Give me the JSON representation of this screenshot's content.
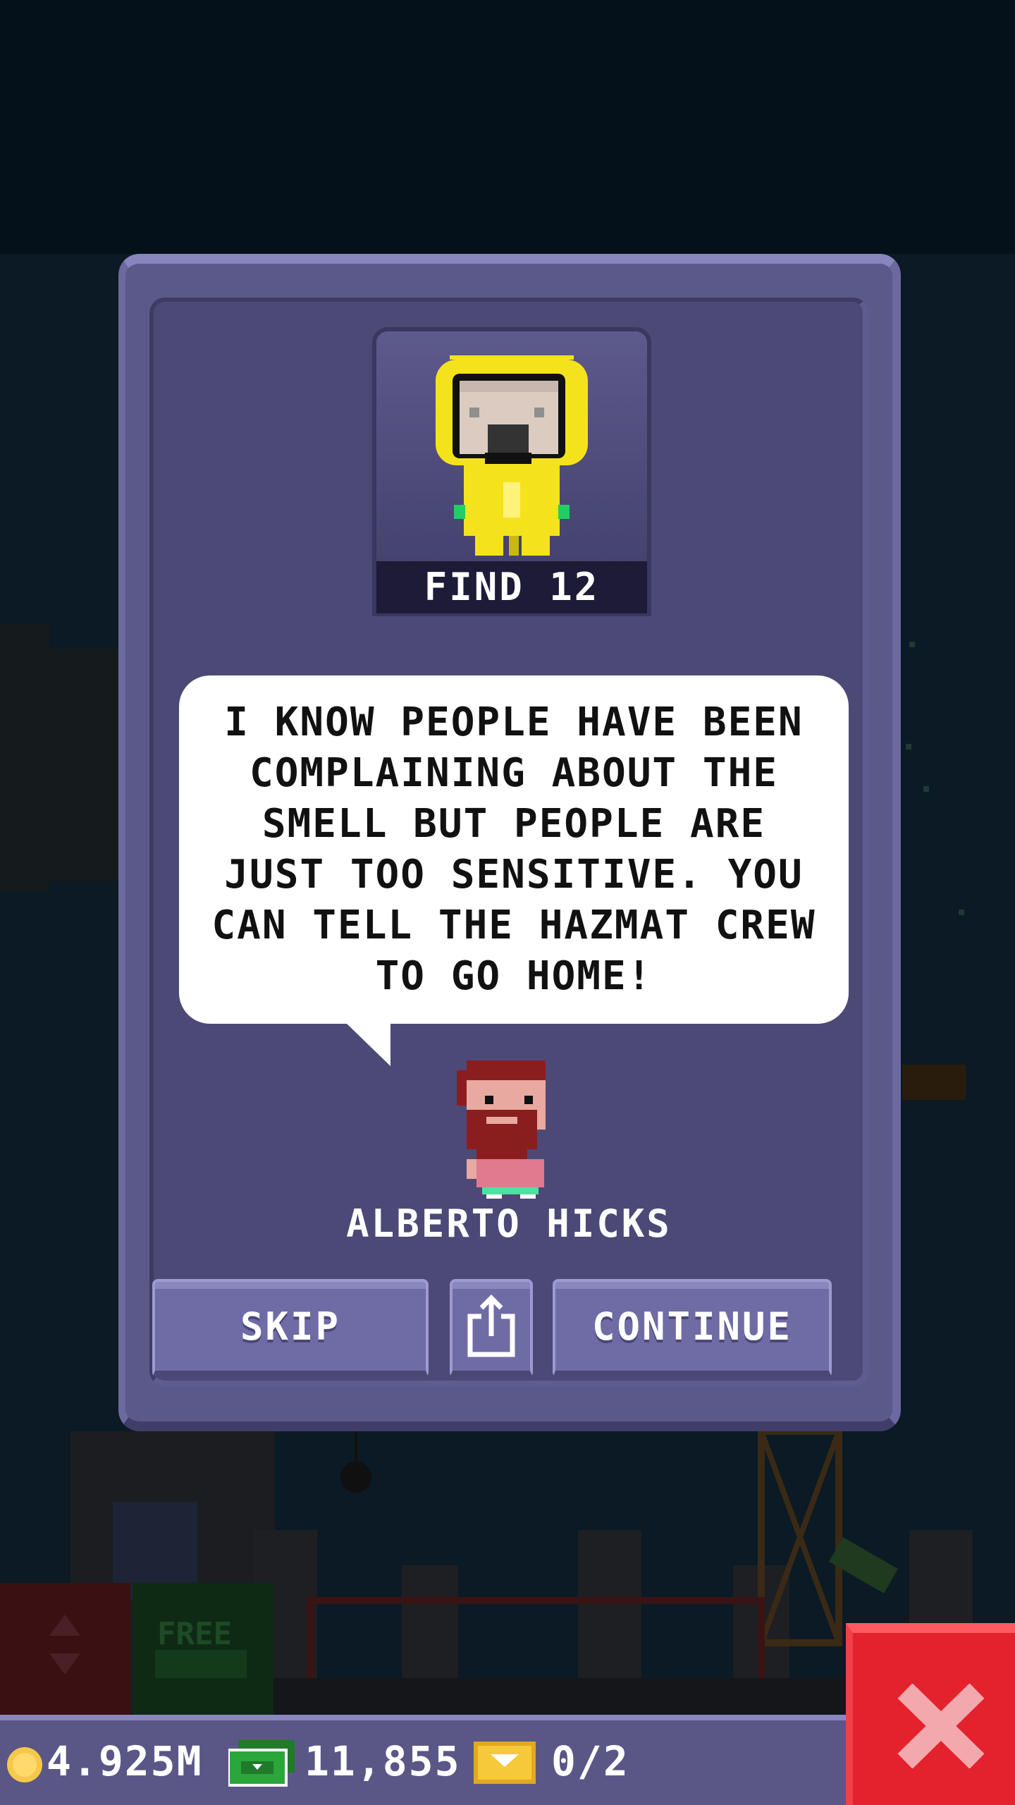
{
  "quest": {
    "find_label": "FIND 12",
    "character": "hazmat-suit-character"
  },
  "dialog": {
    "message": "I KNOW PEOPLE HAVE BEEN COMPLAINING ABOUT THE SMELL BUT PEOPLE ARE JUST TOO SENSITIVE. YOU CAN TELL THE HAZMAT CREW TO GO HOME!",
    "speaker_name": "ALBERTO HICKS"
  },
  "buttons": {
    "skip": "SKIP",
    "share": "share-icon",
    "continue": "CONTINUE"
  },
  "background": {
    "free_label": "FREE"
  },
  "status_bar": {
    "coins": "4.925M",
    "bux": "11,855",
    "tickets": "0/2"
  },
  "colors": {
    "panel": "#5b5989",
    "button": "#6f6ca5",
    "close": "#e3222d",
    "hazmat_yellow": "#f4e31c"
  }
}
